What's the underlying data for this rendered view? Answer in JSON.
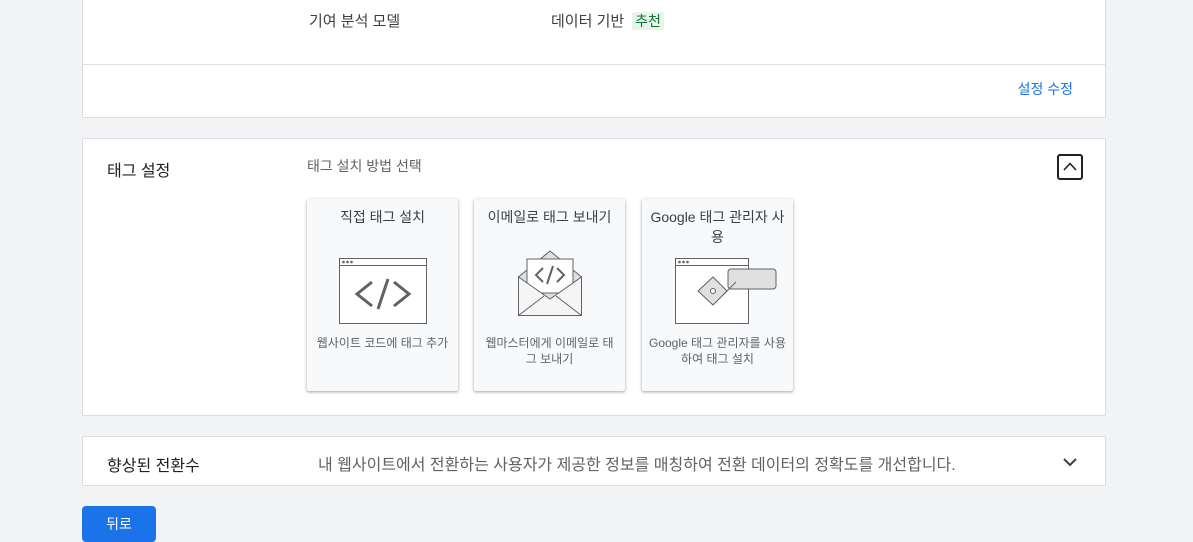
{
  "attribution": {
    "label": "기여 분석 모델",
    "value": "데이터 기반",
    "badge": "추천",
    "edit_link": "설정 수정"
  },
  "tag_setup": {
    "title": "태그 설정",
    "subtitle": "태그 설치 방법 선택",
    "collapse_icon": "chevron-up-icon",
    "options": [
      {
        "title": "직접 태그 설치",
        "description": "웹사이트 코드에 태그 추가",
        "icon": "code-window-icon"
      },
      {
        "title": "이메일로 태그 보내기",
        "description": "웹마스터에게 이메일로 태그 보내기",
        "icon": "code-envelope-icon"
      },
      {
        "title": "Google 태그 관리자 사용",
        "description": "Google 태그 관리자를 사용하여 태그 설치",
        "icon": "tag-manager-window-icon"
      }
    ]
  },
  "enhanced_conversions": {
    "title": "향상된 전환수",
    "description": "내 웹사이트에서 전환하는 사용자가 제공한 정보를 매칭하여 전환 데이터의 정확도를 개선합니다.",
    "expand_icon": "chevron-down-icon"
  },
  "footer": {
    "back_label": "뒤로"
  },
  "colors": {
    "accent": "#1a73e8",
    "badge_bg": "#e6f4ea",
    "badge_text": "#137333"
  }
}
